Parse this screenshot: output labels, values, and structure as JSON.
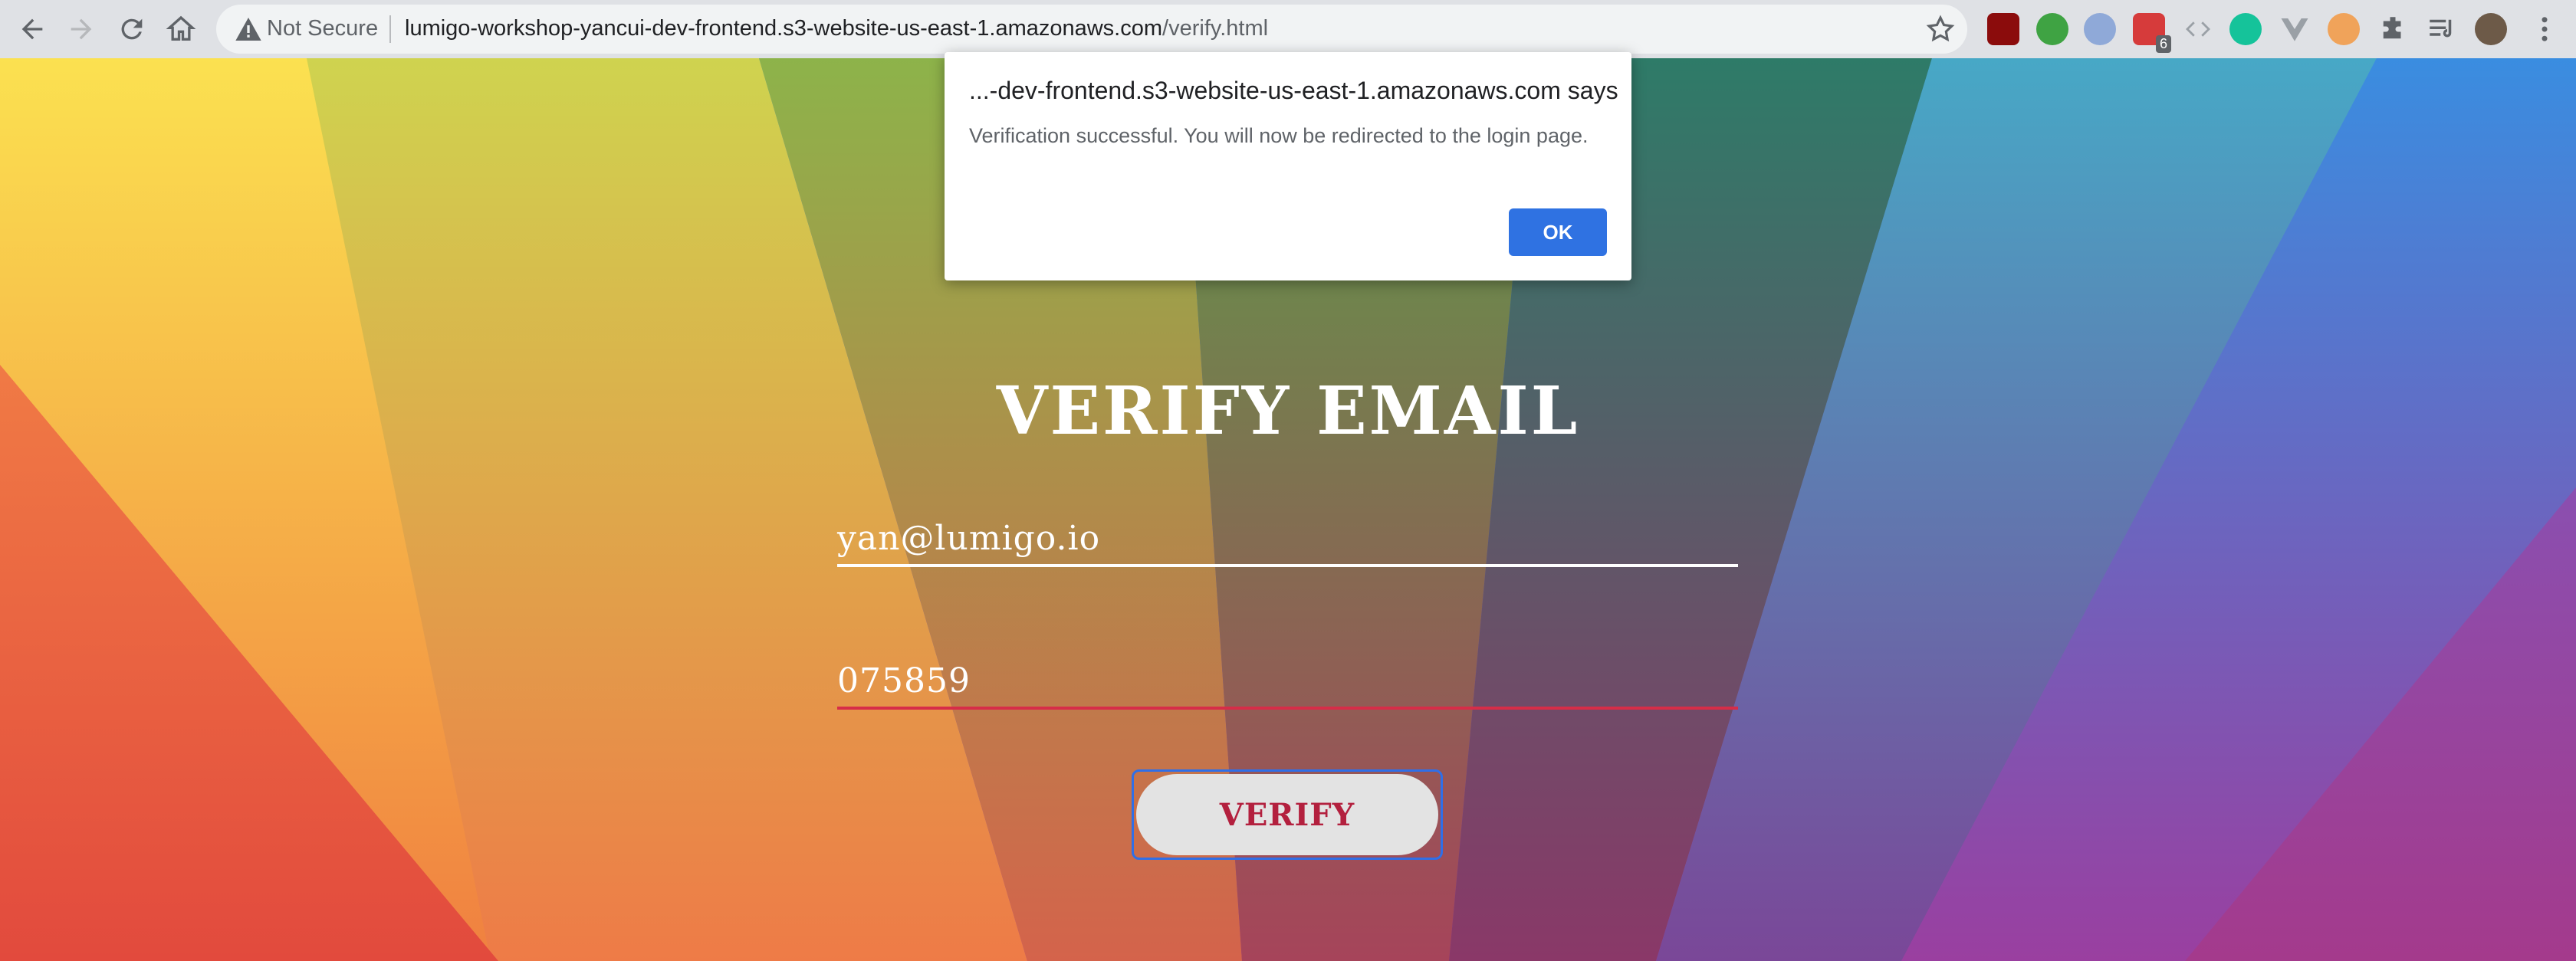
{
  "browser": {
    "security_label": "Not Secure",
    "url_host": "lumigo-workshop-yancui-dev-frontend.s3-website-us-east-1.amazonaws.com",
    "url_path": "/verify.html",
    "extension_badge": "6"
  },
  "dialog": {
    "origin": "...-dev-frontend.s3-website-us-east-1.amazonaws.com says",
    "message": "Verification successful. You will now be redirected to the login page.",
    "ok_label": "OK"
  },
  "form": {
    "title": "VERIFY EMAIL",
    "email_value": "yan@lumigo.io",
    "code_value": "075859",
    "verify_label": "VERIFY"
  },
  "colors": {
    "dialog_button": "#2f72e2",
    "verify_text": "#b3203e",
    "code_underline": "#d72d48",
    "focus_ring": "#2f6fe8"
  }
}
